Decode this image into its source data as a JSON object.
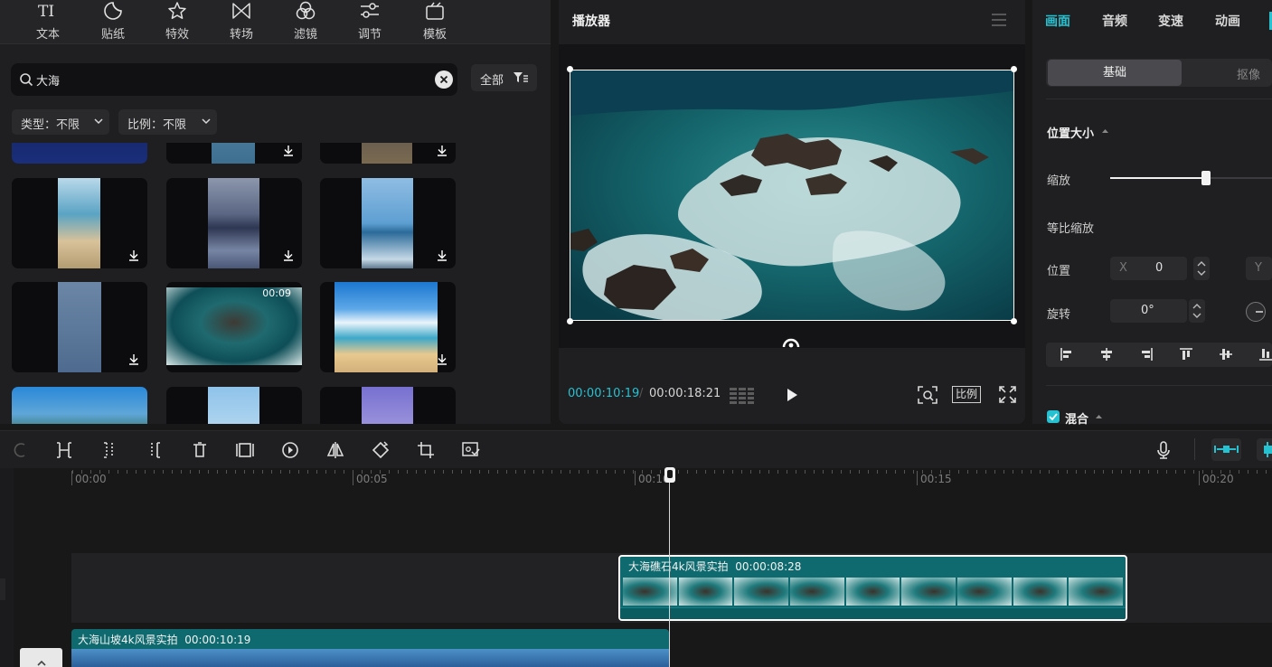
{
  "top_tabs": [
    {
      "label": "文本",
      "icon": "text-icon"
    },
    {
      "label": "贴纸",
      "icon": "sticker-icon"
    },
    {
      "label": "特效",
      "icon": "effects-icon"
    },
    {
      "label": "转场",
      "icon": "transition-icon"
    },
    {
      "label": "滤镜",
      "icon": "filter-icon"
    },
    {
      "label": "调节",
      "icon": "adjust-icon"
    },
    {
      "label": "模板",
      "icon": "template-icon"
    }
  ],
  "search": {
    "value": "大海"
  },
  "filter_all_label": "全部",
  "dropdowns": {
    "type": "类型：不限",
    "ratio": "比例：不限"
  },
  "media_grid": {
    "durations": [
      "00:09"
    ]
  },
  "player": {
    "title": "播放器",
    "current_time": "00:00:10:19",
    "separator": "/",
    "total_time": "00:00:18:21",
    "ratio_label": "比例"
  },
  "inspector": {
    "tabs": [
      "画面",
      "音频",
      "变速",
      "动画"
    ],
    "active_tab": "画面",
    "segments": [
      "基础",
      "抠像"
    ],
    "section_title": "位置大小",
    "scale_label": "缩放",
    "scale_level": 0.59,
    "uniform_label": "等比缩放",
    "position_label": "位置",
    "x_label": "X",
    "x_value": "0",
    "y_label": "Y",
    "rotation_label": "旋转",
    "rotation_value": "0°",
    "blend_label": "混合",
    "blend_checked": true
  },
  "timeline": {
    "ruler_labels": [
      "00:00",
      "00:05",
      "00:10",
      "00:15",
      "00:20"
    ],
    "clips": [
      {
        "name": "大海礁石4k风景实拍",
        "duration": "00:00:08:28"
      },
      {
        "name": "大海山坡4k风景实拍",
        "duration": "00:00:10:19"
      }
    ]
  },
  "colors": {
    "accent": "#26c2d2",
    "clip": "#0e6a6e",
    "panel": "#1f1f21"
  }
}
